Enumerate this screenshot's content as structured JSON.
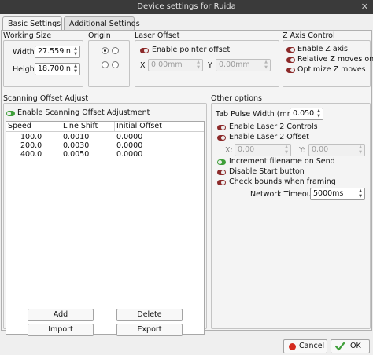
{
  "window": {
    "title": "Device settings for Ruida"
  },
  "tabs": [
    {
      "label": "Basic Settings"
    },
    {
      "label": "Additional Settings"
    }
  ],
  "working_size": {
    "title": "Working Size",
    "width_label": "Width",
    "width_value": "27.559in",
    "height_label": "Height",
    "height_value": "18.700in"
  },
  "origin": {
    "title": "Origin",
    "selected": "top-left"
  },
  "laser_offset": {
    "title": "Laser Offset",
    "enable_label": "Enable pointer offset",
    "x_label": "X",
    "x_value": "0.00mm",
    "y_label": "Y",
    "y_value": "0.00mm"
  },
  "z_axis": {
    "title": "Z Axis Control",
    "items": [
      {
        "label": "Enable Z axis"
      },
      {
        "label": "Relative Z moves only"
      },
      {
        "label": "Optimize Z moves"
      }
    ]
  },
  "scanning": {
    "title": "Scanning Offset Adjust",
    "enable_label": "Enable Scanning Offset Adjustment",
    "columns": [
      "Speed",
      "Line Shift",
      "Initial Offset"
    ],
    "rows": [
      [
        "100.0",
        "0.0010",
        "0.0000"
      ],
      [
        "200.0",
        "0.0030",
        "0.0000"
      ],
      [
        "400.0",
        "0.0050",
        "0.0000"
      ]
    ],
    "add_label": "Add",
    "delete_label": "Delete",
    "import_label": "Import",
    "export_label": "Export"
  },
  "other": {
    "title": "Other options",
    "tab_pulse_label": "Tab Pulse Width (mm)",
    "tab_pulse_value": "0.050",
    "enable_laser2_controls": "Enable Laser 2 Controls",
    "enable_laser2_offset": "Enable Laser 2 Offset",
    "x_label": "X:",
    "x_value": "0.00",
    "y_label": "Y:",
    "y_value": "0.00",
    "increment_filename": "Increment filename on Send",
    "disable_start": "Disable Start button",
    "check_bounds": "Check bounds when framing",
    "network_timeout_label": "Network Timeout",
    "network_timeout_value": "5000ms"
  },
  "dialog": {
    "cancel_label": "Cancel",
    "ok_label": "OK"
  },
  "colors": {
    "toggle_off": "#8c2a2a",
    "toggle_on": "#3f9f3a",
    "cancel_icon": "#d42a1f",
    "ok_icon": "#3f9f3a"
  }
}
